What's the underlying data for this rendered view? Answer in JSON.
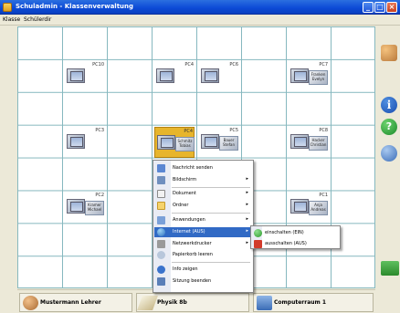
{
  "window": {
    "title": "Schuladmin - Klassenverwaltung",
    "controls": {
      "minimize": "_",
      "maximize": "□",
      "close": "×"
    }
  },
  "menubar": {
    "items": [
      "Klasse",
      "Schülerdir"
    ]
  },
  "computers": [
    {
      "id": "PC10",
      "label": "PC10",
      "student": ""
    },
    {
      "id": "PC4",
      "label": "PC4",
      "student": ""
    },
    {
      "id": "PC6",
      "label": "PC6",
      "student": ""
    },
    {
      "id": "PC7",
      "label": "PC7",
      "student": "Franken Evelyn"
    },
    {
      "id": "PC3",
      "label": "PC3",
      "student": ""
    },
    {
      "id": "PC4b",
      "label": "PC4",
      "student": "Schmitz Tobias",
      "selected": true
    },
    {
      "id": "PC5",
      "label": "PC5",
      "student": "Bauer Stefan"
    },
    {
      "id": "PC8",
      "label": "PC8",
      "student": "Hacker Christian"
    },
    {
      "id": "PC2",
      "label": "PC2",
      "student": "Kramer Michael"
    },
    {
      "id": "PC1",
      "label": "PC1",
      "student": "Anja Andreas"
    }
  ],
  "context_menu": {
    "items": [
      {
        "label": "Nachricht senden",
        "icon": "message-icon",
        "submenu": false
      },
      {
        "label": "Bildschirm",
        "icon": "screen-icon",
        "submenu": true
      },
      {
        "label": "Dokument",
        "icon": "document-icon",
        "submenu": true
      },
      {
        "label": "Ordner",
        "icon": "folder-icon",
        "submenu": true
      },
      {
        "label": "Anwendungen",
        "icon": "applications-icon",
        "submenu": true
      },
      {
        "label": "Internet (AUS)",
        "icon": "internet-icon",
        "submenu": true,
        "active": true
      },
      {
        "label": "Netzwerkdrucker",
        "icon": "printer-icon",
        "submenu": true
      },
      {
        "label": "Papierkorb leeren",
        "icon": "recycle-bin-icon",
        "submenu": false
      },
      {
        "label": "Info zeigen",
        "icon": "info-icon",
        "submenu": false
      },
      {
        "label": "Sitzung beenden",
        "icon": "logout-icon",
        "submenu": false
      }
    ],
    "arrow": "▸"
  },
  "internet_submenu": {
    "items": [
      {
        "label": "einschalten (EIN)",
        "icon": "internet-on-icon"
      },
      {
        "label": "ausschalten (AUS)",
        "icon": "internet-off-icon"
      }
    ]
  },
  "statusbar": {
    "teacher": "Mustermann Lehrer",
    "subject": "Physik 8b",
    "room": "Computerraum 1"
  },
  "colors": {
    "selected": "#e7b52c",
    "grid_line": "#86b8bf",
    "titlebar": "#0c4ad6",
    "menu_highlight": "#316ac5"
  }
}
